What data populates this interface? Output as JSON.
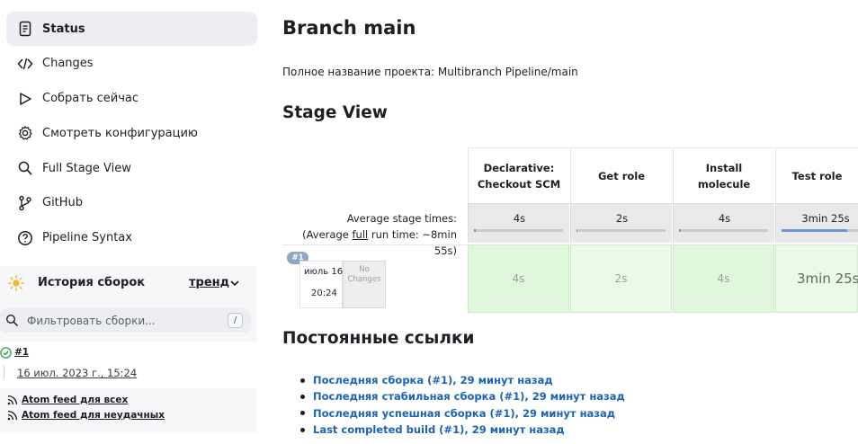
{
  "sidebar": {
    "nav": [
      {
        "label": "Status",
        "icon": "document-icon",
        "active": true
      },
      {
        "label": "Changes",
        "icon": "code-icon"
      },
      {
        "label": "Собрать сейчас",
        "icon": "play-icon"
      },
      {
        "label": "Смотреть конфигурацию",
        "icon": "gear-icon"
      },
      {
        "label": "Full Stage View",
        "icon": "search-icon"
      },
      {
        "label": "GitHub",
        "icon": "branch-icon"
      },
      {
        "label": "Pipeline Syntax",
        "icon": "help-icon"
      }
    ],
    "history": {
      "title": "История сборок",
      "trend": "тренд",
      "filter_placeholder": "Фильтровать сборки...",
      "filter_shortcut": "/",
      "builds": [
        {
          "number": "#1",
          "date": "16 июл. 2023 г., 15:24",
          "status": "success"
        }
      ],
      "feeds": [
        "Atom feed для всех",
        "Atom feed для неудачных"
      ]
    }
  },
  "main": {
    "title": "Branch main",
    "project_full_name": "Полное название проекта: Multibranch Pipeline/main",
    "stage_view_title": "Stage View",
    "permalinks_title": "Постоянные ссылки",
    "permalinks": [
      "Последняя сборка (#1), 29 минут назад",
      "Последняя стабильная сборка (#1), 29 минут назад",
      "Последняя успешная сборка (#1), 29 минут назад",
      "Last completed build (#1), 29 минут назад"
    ]
  },
  "stage_view": {
    "avg_stage_label": "Average stage times:",
    "avg_run_prefix": "(Average ",
    "avg_run_full": "full",
    "avg_run_suffix": " run time: ~8min",
    "avg_run_tail": "55s)",
    "run": {
      "badge": "#1",
      "date": "июль 16",
      "time": "20:24",
      "changes_line1": "No",
      "changes_line2": "Changes"
    },
    "stages": [
      {
        "name_line1": "Declarative:",
        "name_line2": "Checkout SCM",
        "avg": "4s",
        "progress": 0.02,
        "cell": "4s"
      },
      {
        "name_line1": "Get role",
        "name_line2": "",
        "avg": "2s",
        "progress": 0.01,
        "cell": "2s"
      },
      {
        "name_line1": "Install",
        "name_line2": "molecule",
        "avg": "4s",
        "progress": 0.02,
        "cell": "4s"
      },
      {
        "name_line1": "Test role",
        "name_line2": "",
        "avg": "3min 25s",
        "progress": 0.85,
        "cell": "3min 25s"
      }
    ]
  },
  "colors": {
    "accent": "#1a63b6",
    "success_cell": "#dff7db",
    "progress_fill": "#6f93d4",
    "active_nav_bg": "#eceef4"
  }
}
